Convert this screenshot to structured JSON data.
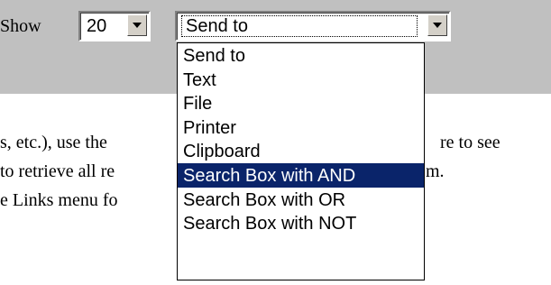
{
  "toolbar": {
    "show_label": "Show",
    "rows_select": {
      "value": "20"
    },
    "sendto_select": {
      "value": "Send to",
      "options": [
        "Send to",
        "Text",
        "File",
        "Printer",
        "Clipboard",
        "Search Box with AND",
        "Search Box with OR",
        "Search Box with NOT"
      ],
      "highlighted_index": 5
    }
  },
  "body_text": {
    "line1_left": "s, etc.), use the",
    "line1_right": "re to see",
    "line2_left": "to retrieve all re",
    "line2_right": "m.",
    "line3_left": "e Links menu fo"
  },
  "colors": {
    "toolbar_bg": "#c0c0c0",
    "highlight_bg": "#0a246a",
    "highlight_text": "#ffffff"
  },
  "icons": {
    "dropdown_arrow": "chevron-down-icon"
  }
}
